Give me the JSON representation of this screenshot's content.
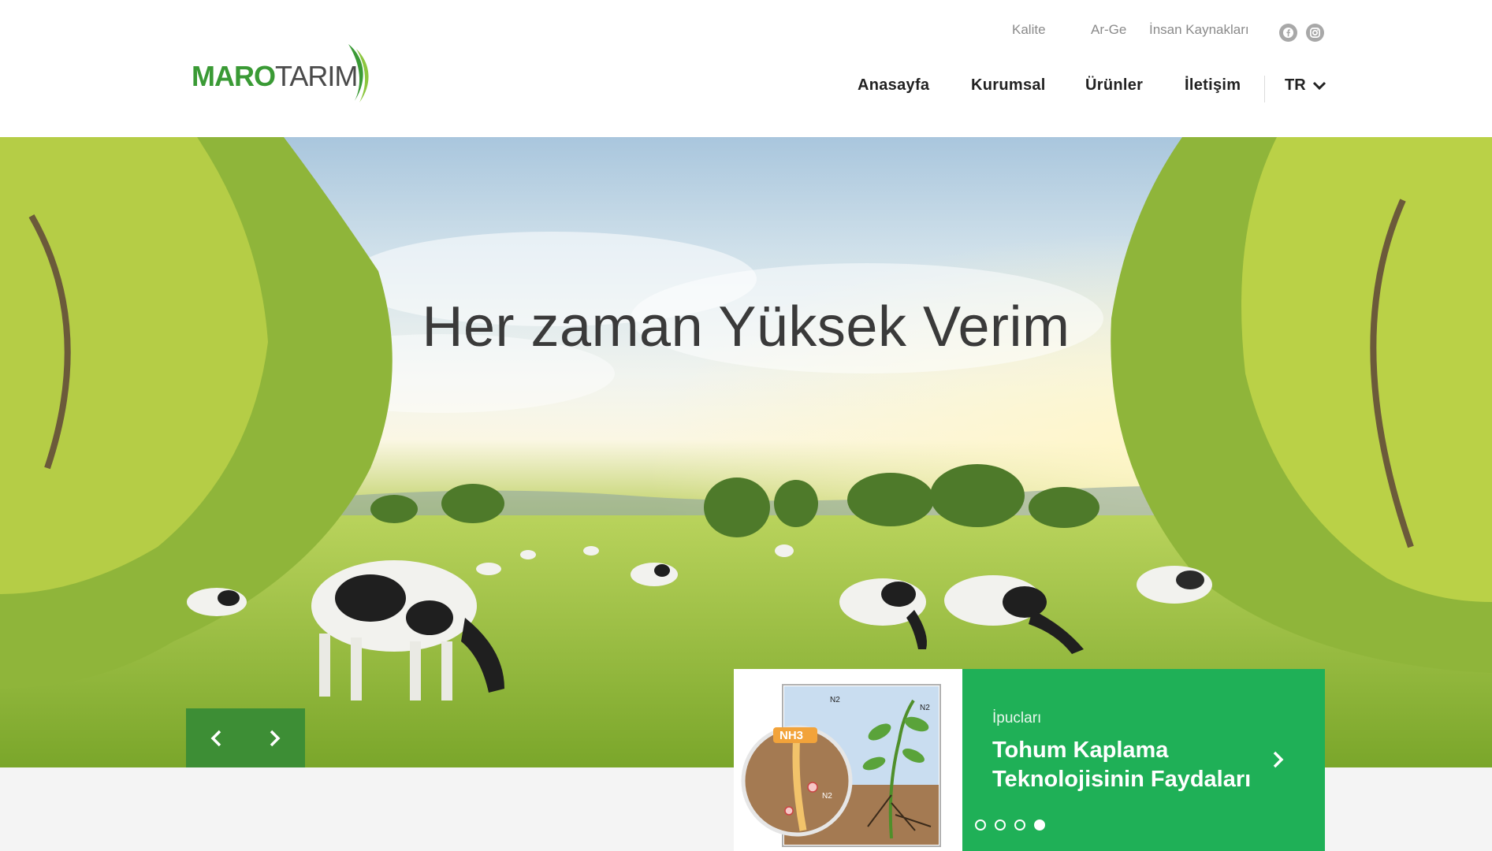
{
  "brand": {
    "name_part1": "MARO",
    "name_part2": "TARIM",
    "green": "#3a9a35",
    "accent_green": "#1fb057",
    "dark_green": "#3d8e35"
  },
  "top_nav": {
    "items": [
      {
        "label": "Kalite"
      },
      {
        "label": "Ar-Ge"
      },
      {
        "label": "İnsan Kaynakları"
      }
    ]
  },
  "social": {
    "icons": [
      "facebook-icon",
      "instagram-icon"
    ]
  },
  "main_nav": {
    "items": [
      {
        "label": "Anasayfa"
      },
      {
        "label": "Kurumsal"
      },
      {
        "label": "Ürünler"
      },
      {
        "label": "İletişim"
      }
    ],
    "language": "TR"
  },
  "hero": {
    "title": "Her zaman Yüksek Verim"
  },
  "tip_card": {
    "category": "İpucları",
    "title": "Tohum Kaplama Teknolojisinin Faydaları",
    "illustration_labels": {
      "ammonia": "NH3",
      "nitrogen": "N2"
    },
    "dots_total": 4,
    "dots_active_index": 4
  }
}
